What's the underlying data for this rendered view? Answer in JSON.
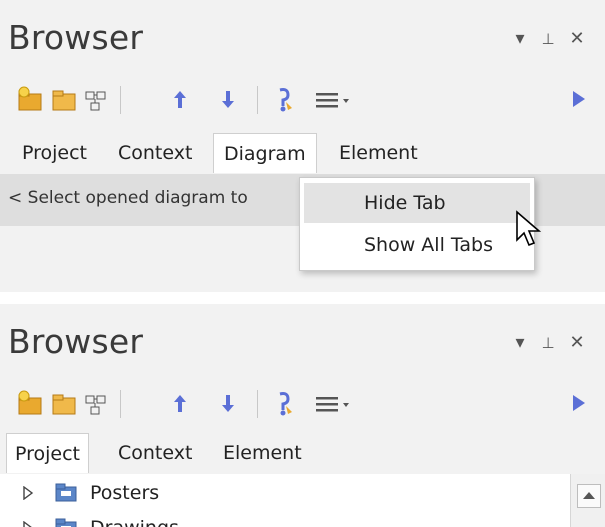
{
  "top_panel": {
    "title": "Browser",
    "window_buttons": {
      "dropdown": "▾",
      "pin": "⊥",
      "close": "✕"
    },
    "tabs": [
      {
        "label": "Project"
      },
      {
        "label": "Context"
      },
      {
        "label": "Diagram",
        "active": true
      },
      {
        "label": "Element"
      }
    ],
    "hint_text": "< Select opened diagram to",
    "context_menu": [
      {
        "label": "Hide Tab",
        "highlighted": true
      },
      {
        "label": "Show All Tabs"
      }
    ]
  },
  "bottom_panel": {
    "title": "Browser",
    "window_buttons": {
      "dropdown": "▾",
      "pin": "⊥",
      "close": "✕"
    },
    "tabs": [
      {
        "label": "Project",
        "active": true
      },
      {
        "label": "Context"
      },
      {
        "label": "Element"
      }
    ],
    "tree": [
      {
        "label": "Posters",
        "icon": "package-folder-icon"
      },
      {
        "label": "Drawings",
        "icon": "package-folder-icon"
      }
    ]
  },
  "toolbar_icons": [
    "new-package-icon",
    "new-folder-icon",
    "diagram-icon",
    "move-up-icon",
    "move-down-icon",
    "properties-icon",
    "menu-icon",
    "run-icon"
  ],
  "colors": {
    "arrow_blue": "#5b6fd6",
    "folder": "#e9a92f",
    "panel_bg": "#f2f2f2",
    "hint_bg": "#dedede",
    "menu_highlight": "#e3e3e3"
  }
}
